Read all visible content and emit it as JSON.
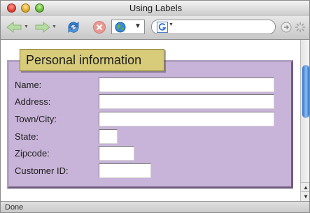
{
  "window": {
    "title": "Using Labels"
  },
  "toolbar": {
    "icons": [
      "back-arrow-icon",
      "forward-arrow-icon",
      "reload-icon",
      "stop-icon",
      "site-globe-icon",
      "google-search-icon",
      "go-icon",
      "progress-spinner-icon"
    ],
    "url_value": "",
    "search_value": ""
  },
  "form": {
    "legend": "Personal information",
    "fields": [
      {
        "label": "Name:",
        "value": ""
      },
      {
        "label": "Address:",
        "value": ""
      },
      {
        "label": "Town/City:",
        "value": ""
      },
      {
        "label": "State:",
        "value": ""
      },
      {
        "label": "Zipcode:",
        "value": ""
      },
      {
        "label": "Customer ID:",
        "value": ""
      }
    ],
    "colors": {
      "fieldset_bg": "#c8b4d8",
      "legend_bg": "#d8cc7a"
    }
  },
  "statusbar": {
    "text": "Done"
  }
}
